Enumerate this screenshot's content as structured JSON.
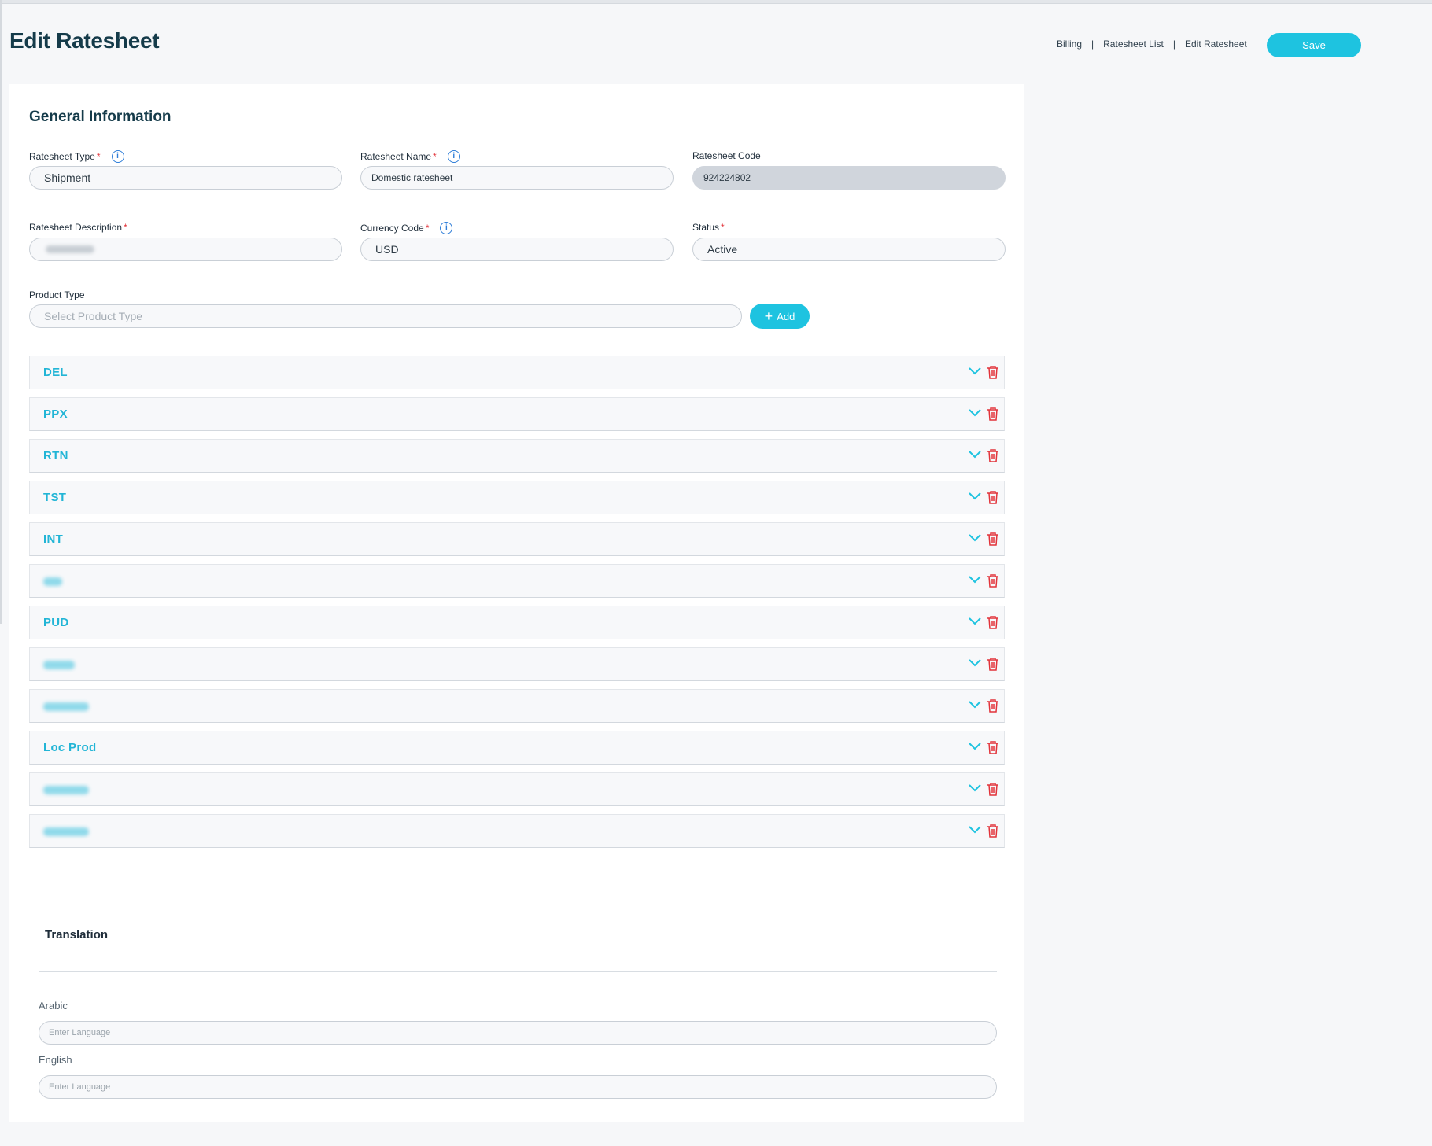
{
  "header": {
    "title": "Edit Ratesheet",
    "breadcrumb": [
      "Billing",
      "Ratesheet List",
      "Edit Ratesheet"
    ],
    "breadcrumb_separator": "|",
    "save_label": "Save"
  },
  "general": {
    "section_title": "General Information",
    "ratesheet_type": {
      "label": "Ratesheet Type",
      "required": "*",
      "value": "Shipment"
    },
    "ratesheet_name": {
      "label": "Ratesheet Name",
      "required": "*",
      "value": "Domestic ratesheet"
    },
    "ratesheet_code": {
      "label": "Ratesheet Code",
      "value": "924224802"
    },
    "ratesheet_description": {
      "label": "Ratesheet Description",
      "required": "*",
      "value": ""
    },
    "currency_code": {
      "label": "Currency Code",
      "required": "*",
      "value": "USD"
    },
    "status": {
      "label": "Status",
      "required": "*",
      "value": "Active"
    },
    "product_type": {
      "label": "Product Type",
      "placeholder": "Select Product Type",
      "add_label": "Add"
    }
  },
  "product_types": [
    {
      "label": "DEL"
    },
    {
      "label": "PPX"
    },
    {
      "label": "RTN"
    },
    {
      "label": "TST"
    },
    {
      "label": "INT"
    },
    {
      "label": ""
    },
    {
      "label": "PUD"
    },
    {
      "label": ""
    },
    {
      "label": ""
    },
    {
      "label": "Loc Prod"
    },
    {
      "label": ""
    },
    {
      "label": ""
    }
  ],
  "translation": {
    "title": "Translation",
    "arabic": {
      "label": "Arabic",
      "placeholder": "Enter Language"
    },
    "english": {
      "label": "English",
      "placeholder": "Enter Language"
    }
  },
  "colors": {
    "accent": "#1ec3e0",
    "product_label": "#22b5d6",
    "delete_icon": "#e2333a",
    "info_icon": "#2f7ed8",
    "title": "#153b4a"
  },
  "icons": {
    "info": "info-icon",
    "expand": "chevron-down-icon",
    "delete": "trash-icon",
    "add": "plus-icon"
  }
}
